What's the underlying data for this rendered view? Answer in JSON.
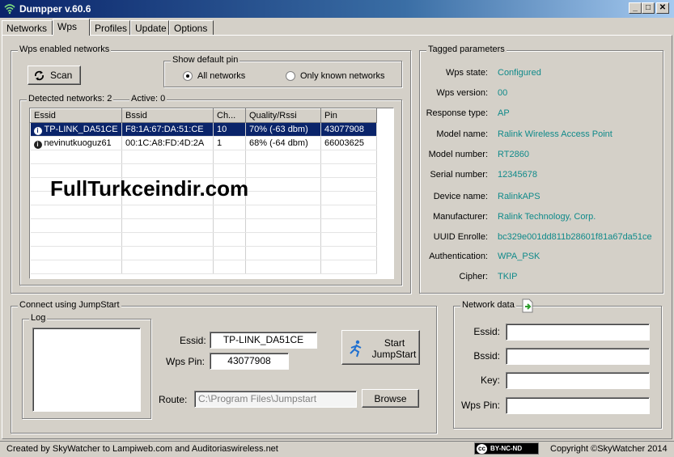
{
  "window": {
    "title": "Dumpper v.60.6",
    "min": "_",
    "max": "□",
    "close": "✕"
  },
  "tabs": [
    {
      "label": "Networks"
    },
    {
      "label": "Wps"
    },
    {
      "label": "Profiles"
    },
    {
      "label": "Update"
    },
    {
      "label": "Options"
    }
  ],
  "wps": {
    "group_title": "Wps enabled networks",
    "scan_label": "Scan",
    "default_pin": {
      "title": "Show default pin",
      "all": "All networks",
      "known": "Only known networks",
      "selected": "all"
    },
    "detected": {
      "title": "Detected networks: 2",
      "active": "Active: 0"
    },
    "columns": [
      "Essid",
      "Bssid",
      "Ch...",
      "Quality/Rssi",
      "Pin"
    ],
    "rows": [
      [
        "TP-LINK_DA51CE",
        "F8:1A:67:DA:51:CE",
        "10",
        "70% (-63 dbm)",
        "43077908"
      ],
      [
        "nevinutkuoguz61",
        "00:1C:A8:FD:4D:2A",
        "1",
        "68% (-64 dbm)",
        "66003625"
      ]
    ],
    "watermark": "FullTurkceindir.com"
  },
  "tagged": {
    "title": "Tagged parameters",
    "items": [
      {
        "label": "Wps state:",
        "value": "Configured"
      },
      {
        "label": "Wps version:",
        "value": "00"
      },
      {
        "label": "Response type:",
        "value": "AP"
      },
      {
        "label": "Model name:",
        "value": "Ralink Wireless Access Point"
      },
      {
        "label": "Model number:",
        "value": "RT2860"
      },
      {
        "label": "Serial number:",
        "value": "12345678"
      },
      {
        "label": "Device name:",
        "value": "RalinkAPS"
      },
      {
        "label": "Manufacturer:",
        "value": "Ralink Technology, Corp."
      },
      {
        "label": "UUID Enrolle:",
        "value": "bc329e001dd811b28601f81a67da51ce"
      },
      {
        "label": "Authentication:",
        "value": "WPA_PSK"
      },
      {
        "label": "Cipher:",
        "value": "TKIP"
      }
    ]
  },
  "jumpstart": {
    "title": "Connect using JumpStart",
    "log_title": "Log",
    "essid_label": "Essid:",
    "essid_value": "TP-LINK_DA51CE",
    "pin_label": "Wps Pin:",
    "pin_value": "43077908",
    "start_line1": "Start",
    "start_line2": "JumpStart",
    "route_label": "Route:",
    "route_value": "C:\\Program Files\\Jumpstart",
    "browse_label": "Browse"
  },
  "network_data": {
    "title": "Network data",
    "essid": "Essid:",
    "bssid": "Bssid:",
    "key": "Key:",
    "pin": "Wps Pin:"
  },
  "status": {
    "left": "Created by SkyWatcher to Lampiweb.com and Auditoriaswireless.net",
    "license": "BY-NC-ND",
    "cc": "cc",
    "right": "Copyright ©SkyWatcher 2014"
  }
}
